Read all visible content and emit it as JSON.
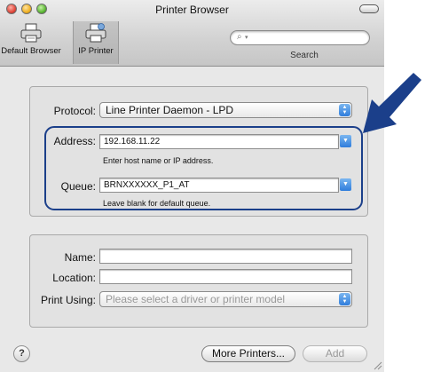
{
  "window": {
    "title": "Printer Browser"
  },
  "toolbar": {
    "default_browser_label": "Default Browser",
    "ip_printer_label": "IP Printer",
    "search_label": "Search",
    "search_placeholder": ""
  },
  "form": {
    "protocol_label": "Protocol:",
    "protocol_value": "Line Printer Daemon - LPD",
    "address_label": "Address:",
    "address_value": "192.168.11.22",
    "address_hint": "Enter host name or IP address.",
    "queue_label": "Queue:",
    "queue_value": "BRNXXXXXX_P1_AT",
    "queue_hint": "Leave blank for default queue."
  },
  "info": {
    "name_label": "Name:",
    "name_value": "",
    "location_label": "Location:",
    "location_value": "",
    "print_using_label": "Print Using:",
    "print_using_value": "Please select a driver or printer model"
  },
  "footer": {
    "help_label": "?",
    "more_printers_label": "More Printers...",
    "add_label": "Add"
  },
  "colors": {
    "annotation": "#1b3f8a",
    "arrow": "#1b3f8a"
  }
}
